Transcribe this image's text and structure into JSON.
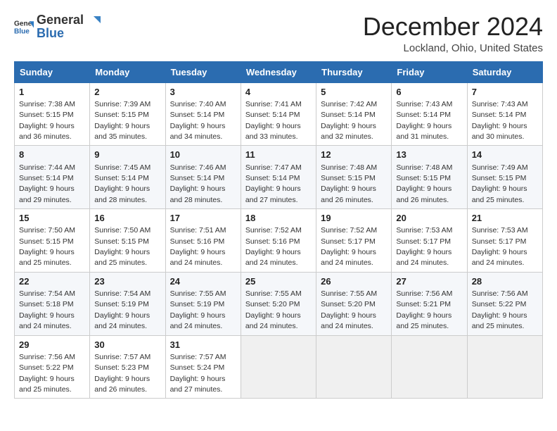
{
  "logo": {
    "general": "General",
    "blue": "Blue"
  },
  "title": "December 2024",
  "location": "Lockland, Ohio, United States",
  "weekdays": [
    "Sunday",
    "Monday",
    "Tuesday",
    "Wednesday",
    "Thursday",
    "Friday",
    "Saturday"
  ],
  "weeks": [
    [
      {
        "day": "1",
        "sunrise": "7:38 AM",
        "sunset": "5:15 PM",
        "daylight": "9 hours and 36 minutes."
      },
      {
        "day": "2",
        "sunrise": "7:39 AM",
        "sunset": "5:15 PM",
        "daylight": "9 hours and 35 minutes."
      },
      {
        "day": "3",
        "sunrise": "7:40 AM",
        "sunset": "5:14 PM",
        "daylight": "9 hours and 34 minutes."
      },
      {
        "day": "4",
        "sunrise": "7:41 AM",
        "sunset": "5:14 PM",
        "daylight": "9 hours and 33 minutes."
      },
      {
        "day": "5",
        "sunrise": "7:42 AM",
        "sunset": "5:14 PM",
        "daylight": "9 hours and 32 minutes."
      },
      {
        "day": "6",
        "sunrise": "7:43 AM",
        "sunset": "5:14 PM",
        "daylight": "9 hours and 31 minutes."
      },
      {
        "day": "7",
        "sunrise": "7:43 AM",
        "sunset": "5:14 PM",
        "daylight": "9 hours and 30 minutes."
      }
    ],
    [
      {
        "day": "8",
        "sunrise": "7:44 AM",
        "sunset": "5:14 PM",
        "daylight": "9 hours and 29 minutes."
      },
      {
        "day": "9",
        "sunrise": "7:45 AM",
        "sunset": "5:14 PM",
        "daylight": "9 hours and 28 minutes."
      },
      {
        "day": "10",
        "sunrise": "7:46 AM",
        "sunset": "5:14 PM",
        "daylight": "9 hours and 28 minutes."
      },
      {
        "day": "11",
        "sunrise": "7:47 AM",
        "sunset": "5:14 PM",
        "daylight": "9 hours and 27 minutes."
      },
      {
        "day": "12",
        "sunrise": "7:48 AM",
        "sunset": "5:15 PM",
        "daylight": "9 hours and 26 minutes."
      },
      {
        "day": "13",
        "sunrise": "7:48 AM",
        "sunset": "5:15 PM",
        "daylight": "9 hours and 26 minutes."
      },
      {
        "day": "14",
        "sunrise": "7:49 AM",
        "sunset": "5:15 PM",
        "daylight": "9 hours and 25 minutes."
      }
    ],
    [
      {
        "day": "15",
        "sunrise": "7:50 AM",
        "sunset": "5:15 PM",
        "daylight": "9 hours and 25 minutes."
      },
      {
        "day": "16",
        "sunrise": "7:50 AM",
        "sunset": "5:15 PM",
        "daylight": "9 hours and 25 minutes."
      },
      {
        "day": "17",
        "sunrise": "7:51 AM",
        "sunset": "5:16 PM",
        "daylight": "9 hours and 24 minutes."
      },
      {
        "day": "18",
        "sunrise": "7:52 AM",
        "sunset": "5:16 PM",
        "daylight": "9 hours and 24 minutes."
      },
      {
        "day": "19",
        "sunrise": "7:52 AM",
        "sunset": "5:17 PM",
        "daylight": "9 hours and 24 minutes."
      },
      {
        "day": "20",
        "sunrise": "7:53 AM",
        "sunset": "5:17 PM",
        "daylight": "9 hours and 24 minutes."
      },
      {
        "day": "21",
        "sunrise": "7:53 AM",
        "sunset": "5:17 PM",
        "daylight": "9 hours and 24 minutes."
      }
    ],
    [
      {
        "day": "22",
        "sunrise": "7:54 AM",
        "sunset": "5:18 PM",
        "daylight": "9 hours and 24 minutes."
      },
      {
        "day": "23",
        "sunrise": "7:54 AM",
        "sunset": "5:19 PM",
        "daylight": "9 hours and 24 minutes."
      },
      {
        "day": "24",
        "sunrise": "7:55 AM",
        "sunset": "5:19 PM",
        "daylight": "9 hours and 24 minutes."
      },
      {
        "day": "25",
        "sunrise": "7:55 AM",
        "sunset": "5:20 PM",
        "daylight": "9 hours and 24 minutes."
      },
      {
        "day": "26",
        "sunrise": "7:55 AM",
        "sunset": "5:20 PM",
        "daylight": "9 hours and 24 minutes."
      },
      {
        "day": "27",
        "sunrise": "7:56 AM",
        "sunset": "5:21 PM",
        "daylight": "9 hours and 25 minutes."
      },
      {
        "day": "28",
        "sunrise": "7:56 AM",
        "sunset": "5:22 PM",
        "daylight": "9 hours and 25 minutes."
      }
    ],
    [
      {
        "day": "29",
        "sunrise": "7:56 AM",
        "sunset": "5:22 PM",
        "daylight": "9 hours and 25 minutes."
      },
      {
        "day": "30",
        "sunrise": "7:57 AM",
        "sunset": "5:23 PM",
        "daylight": "9 hours and 26 minutes."
      },
      {
        "day": "31",
        "sunrise": "7:57 AM",
        "sunset": "5:24 PM",
        "daylight": "9 hours and 27 minutes."
      },
      null,
      null,
      null,
      null
    ]
  ]
}
